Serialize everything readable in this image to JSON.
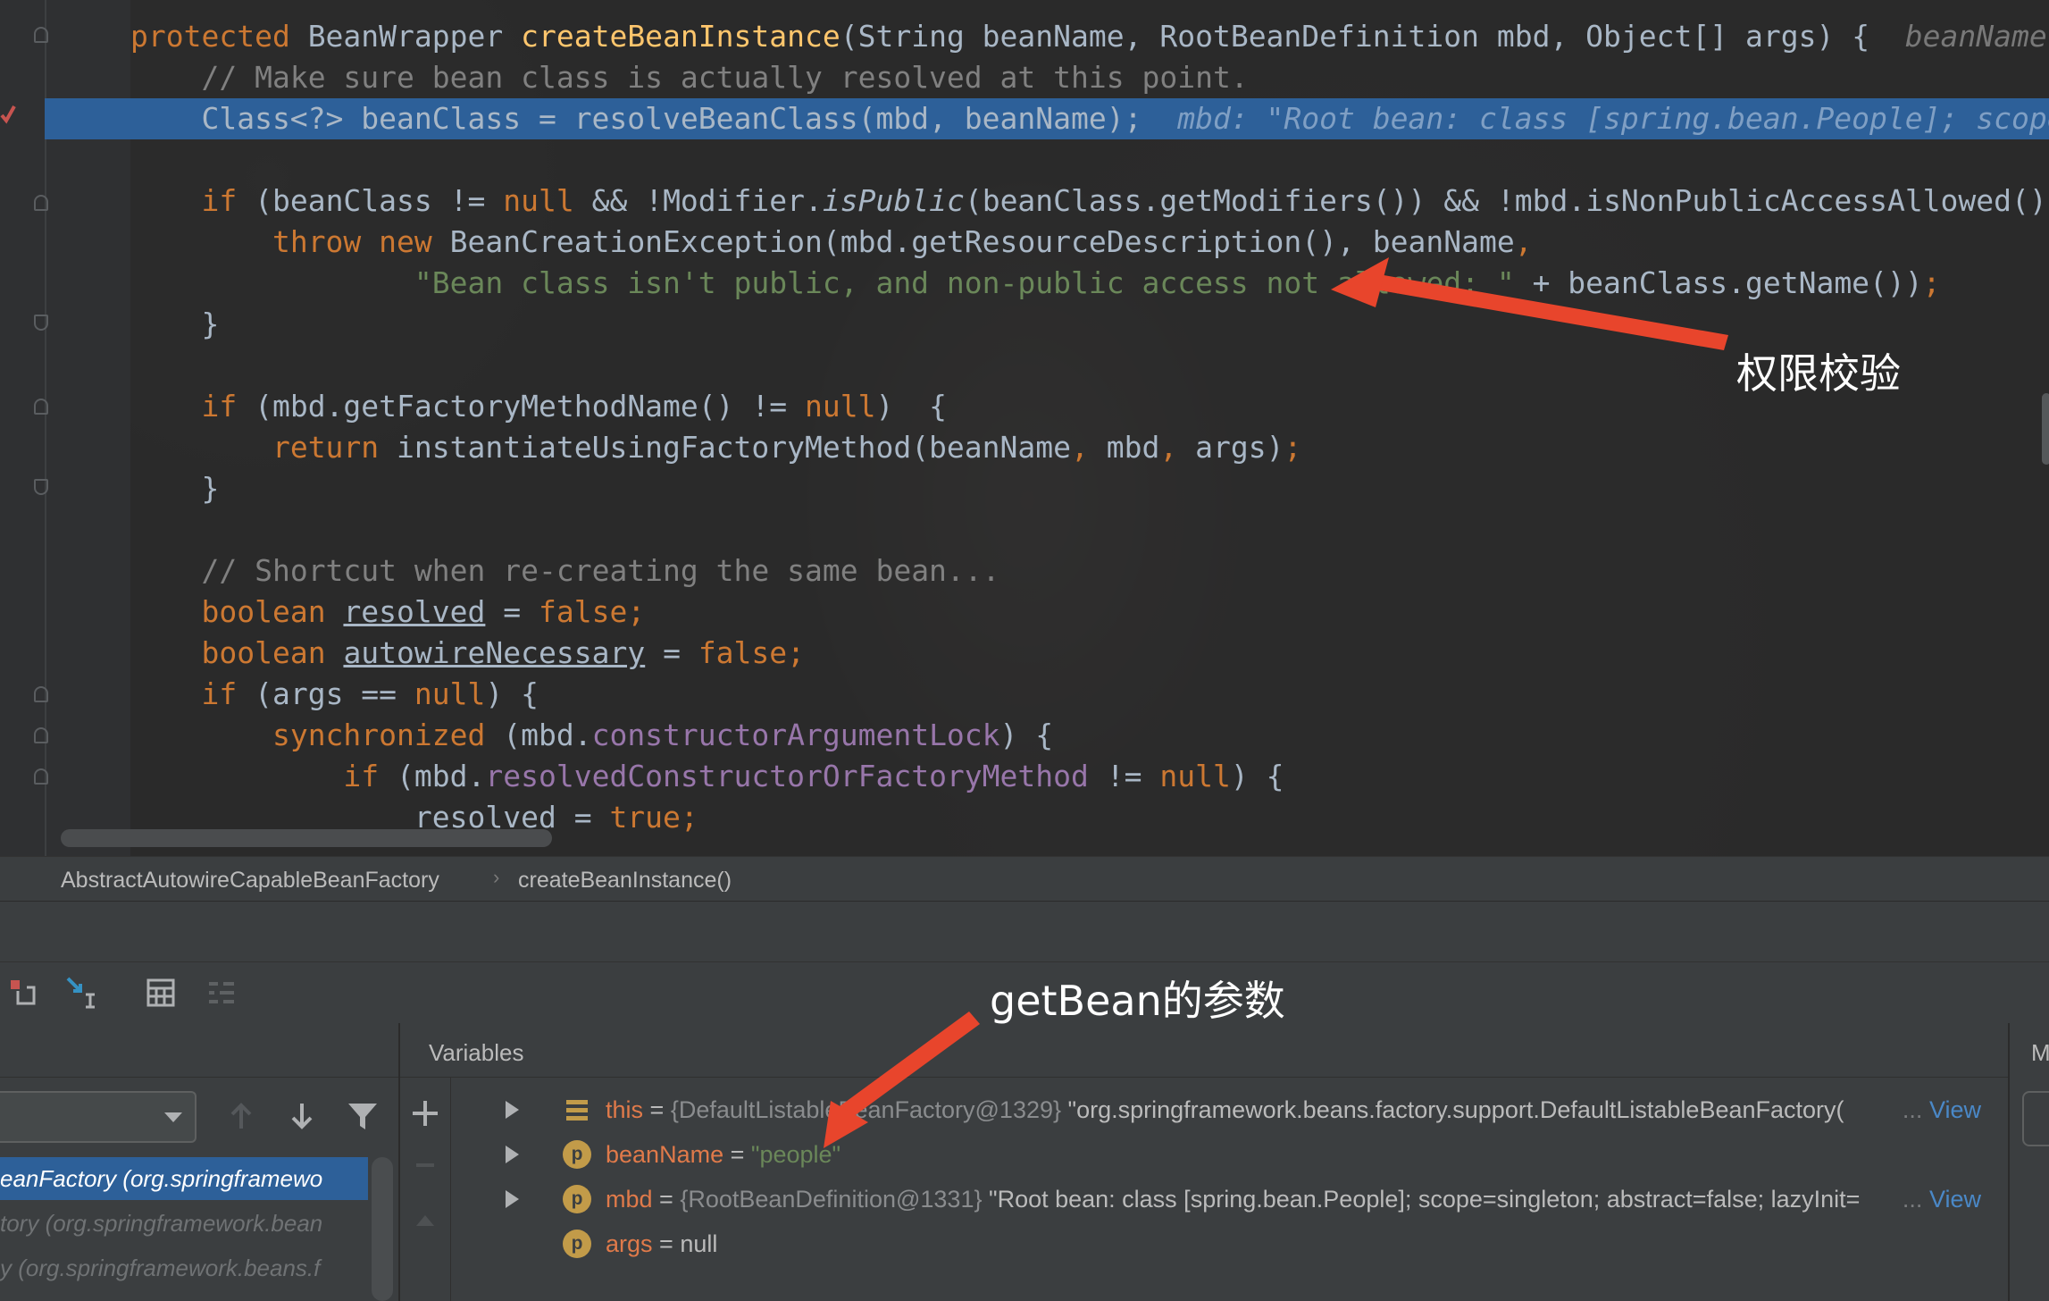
{
  "editor": {
    "lines": [
      {
        "segs": [
          [
            "kw",
            "protected "
          ],
          [
            "",
            "BeanWrapper "
          ],
          [
            "fn",
            "createBeanInstance"
          ],
          [
            "",
            "(String beanName, RootBeanDefinition mbd, Object[] args) {  "
          ],
          [
            "hint-grey",
            "beanName"
          ]
        ]
      },
      {
        "segs": [
          [
            "",
            "    "
          ],
          [
            "cm",
            "// Make sure bean class is actually resolved at this point."
          ]
        ]
      },
      {
        "segs": [
          [
            "",
            "    Class<?> beanClass = resolveBeanClass(mbd, beanName);  "
          ],
          [
            "hint",
            "mbd: \"Root bean: class [spring.bean.People]; scope"
          ]
        ]
      },
      {
        "segs": [
          [
            "",
            ""
          ]
        ]
      },
      {
        "segs": [
          [
            "",
            "    "
          ],
          [
            "kw",
            "if "
          ],
          [
            "",
            "(beanClass != "
          ],
          [
            "kw",
            "null "
          ],
          [
            "",
            "&& !Modifier."
          ],
          [
            "it",
            "isPublic"
          ],
          [
            "",
            "(beanClass.getModifiers()) && !mbd.isNonPublicAccessAllowed()"
          ]
        ]
      },
      {
        "segs": [
          [
            "",
            "        "
          ],
          [
            "kw",
            "throw new "
          ],
          [
            "",
            "BeanCreationException(mbd.getResourceDescription(), beanName"
          ],
          [
            "kw",
            ","
          ]
        ]
      },
      {
        "segs": [
          [
            "",
            "                "
          ],
          [
            "st",
            "\"Bean class isn't public, and non-public access not allowed: \" "
          ],
          [
            "",
            "+ beanClass.getName())"
          ],
          [
            "kw",
            ";"
          ]
        ]
      },
      {
        "segs": [
          [
            "",
            "    }"
          ]
        ]
      },
      {
        "segs": [
          [
            "",
            ""
          ]
        ]
      },
      {
        "segs": [
          [
            "",
            "    "
          ],
          [
            "kw",
            "if "
          ],
          [
            "",
            "(mbd.getFactoryMethodName() != "
          ],
          [
            "kw",
            "null"
          ],
          [
            "",
            ")  {"
          ]
        ]
      },
      {
        "segs": [
          [
            "",
            "        "
          ],
          [
            "kw",
            "return "
          ],
          [
            "",
            "instantiateUsingFactoryMethod(beanName"
          ],
          [
            "kw",
            ", "
          ],
          [
            "",
            "mbd"
          ],
          [
            "kw",
            ", "
          ],
          [
            "",
            "args)"
          ],
          [
            "kw",
            ";"
          ]
        ]
      },
      {
        "segs": [
          [
            "",
            "    }"
          ]
        ]
      },
      {
        "segs": [
          [
            "",
            ""
          ]
        ]
      },
      {
        "segs": [
          [
            "",
            "    "
          ],
          [
            "cm",
            "// Shortcut when re-creating the same bean..."
          ]
        ]
      },
      {
        "segs": [
          [
            "",
            "    "
          ],
          [
            "kw",
            "boolean "
          ],
          [
            "ul",
            "resolved"
          ],
          [
            "",
            " = "
          ],
          [
            "kw",
            "false;"
          ]
        ]
      },
      {
        "segs": [
          [
            "",
            "    "
          ],
          [
            "kw",
            "boolean "
          ],
          [
            "ul",
            "autowireNecessary"
          ],
          [
            "",
            " = "
          ],
          [
            "kw",
            "false;"
          ]
        ]
      },
      {
        "segs": [
          [
            "",
            "    "
          ],
          [
            "kw",
            "if "
          ],
          [
            "",
            "(args == "
          ],
          [
            "kw",
            "null"
          ],
          [
            "",
            ") {"
          ]
        ]
      },
      {
        "segs": [
          [
            "",
            "        "
          ],
          [
            "kw",
            "synchronized "
          ],
          [
            "",
            "(mbd."
          ],
          [
            "fld",
            "constructorArgumentLock"
          ],
          [
            "",
            ") {"
          ]
        ]
      },
      {
        "segs": [
          [
            "",
            "            "
          ],
          [
            "kw",
            "if "
          ],
          [
            "",
            "(mbd."
          ],
          [
            "fld",
            "resolvedConstructorOrFactoryMethod"
          ],
          [
            "",
            " != "
          ],
          [
            "kw",
            "null"
          ],
          [
            "",
            ") {"
          ]
        ]
      },
      {
        "segs": [
          [
            "",
            "                resolved = "
          ],
          [
            "kw",
            "true;"
          ]
        ]
      }
    ],
    "current_line_index": 2
  },
  "breadcrumb": {
    "class_name": "AbstractAutowireCapableBeanFactory",
    "method_name": "createBeanInstance()"
  },
  "frames": {
    "rows": [
      {
        "text": "eanFactory (org.springframewo",
        "state": "selected"
      },
      {
        "text": "tory (org.springframework.bean",
        "state": "dim"
      },
      {
        "text": "y (org.springframework.beans.f",
        "state": "dim"
      }
    ]
  },
  "variables": {
    "title": "Variables",
    "right_panel_initial": "M",
    "rows": [
      {
        "expandable": true,
        "icon": "field-list-icon",
        "name": "this",
        "eq": " = ",
        "type": "{DefaultListableBeanFactory@1329} ",
        "value": "\"org.springframework.beans.factory.support.DefaultListableBeanFactory(",
        "link_dots": "...",
        "link": "View"
      },
      {
        "expandable": true,
        "icon": "p",
        "name": "beanName",
        "eq": " = ",
        "type": "",
        "value_str": "\"people\""
      },
      {
        "expandable": true,
        "icon": "p",
        "name": "mbd",
        "eq": " = ",
        "type": "{RootBeanDefinition@1331} ",
        "value": "\"Root bean: class [spring.bean.People]; scope=singleton; abstract=false; lazyInit=",
        "link_dots": "...",
        "link": "View"
      },
      {
        "expandable": false,
        "icon": "p",
        "name": "args",
        "eq": " = ",
        "type": "",
        "value": "null"
      }
    ]
  },
  "annotations": {
    "permission_check": "权限校验",
    "getbean_params": "getBean的参数"
  },
  "colors": {
    "current_line": "#2d6099",
    "arrow": "#e8452c",
    "keyword": "#cc7832",
    "string": "#6a8759"
  }
}
